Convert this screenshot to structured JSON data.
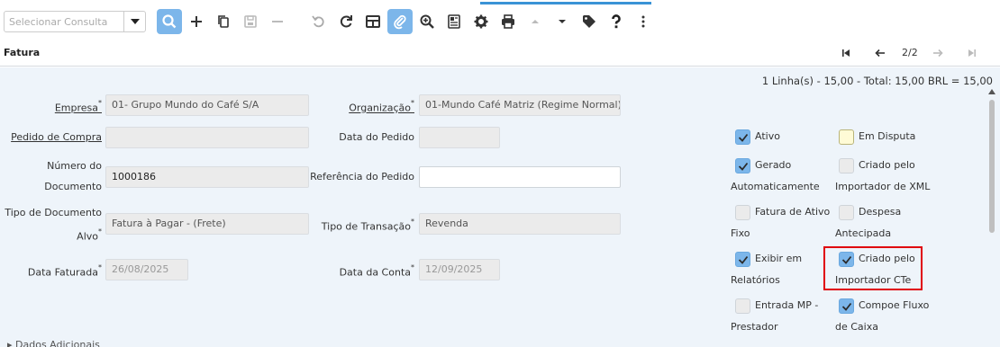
{
  "toolbar": {
    "query_placeholder": "Selecionar Consulta"
  },
  "titlebar": {
    "title": "Fatura",
    "page_count": "2/2"
  },
  "summary": "1 Linha(s) - 15,00 - Total: 15,00 BRL = 15,00",
  "form": {
    "empresa_label": "Empresa",
    "empresa_value": "01- Grupo Mundo do Café S/A",
    "organizacao_label": "Organização",
    "organizacao_value": "01-Mundo Café Matriz (Regime Normal)",
    "pedido_compra_label": "Pedido de Compra",
    "pedido_compra_value": "",
    "data_pedido_label": "Data do Pedido",
    "data_pedido_value": "",
    "numero_doc_label_1": "Número do",
    "numero_doc_label_2": "Documento",
    "numero_doc_value": "1000186",
    "referencia_label": "Referência do Pedido",
    "referencia_value": "",
    "tipo_doc_label_1": "Tipo de Documento",
    "tipo_doc_label_2": "Alvo",
    "tipo_doc_value": "Fatura à Pagar - (Frete)",
    "tipo_transacao_label": "Tipo de Transação",
    "tipo_transacao_value": "Revenda",
    "data_faturada_label": "Data Faturada",
    "data_faturada_value": "26/08/2025",
    "data_conta_label": "Data da Conta",
    "data_conta_value": "12/09/2025",
    "required_mark": "*"
  },
  "checkboxes": {
    "ativo": {
      "label": "Ativo",
      "checked": true
    },
    "em_disputa": {
      "label": "Em Disputa",
      "checked": false
    },
    "gerado_1": "Gerado",
    "gerado_2": "Automaticamente",
    "gerado_checked": true,
    "criado_xml_1": "Criado pelo",
    "criado_xml_2": "Importador de XML",
    "criado_xml_checked": false,
    "fatura_ativo_1": "Fatura de Ativo",
    "fatura_ativo_2": "Fixo",
    "fatura_ativo_checked": false,
    "despesa_1": "Despesa",
    "despesa_2": "Antecipada",
    "despesa_checked": false,
    "exibir_1": "Exibir em",
    "exibir_2": "Relatórios",
    "exibir_checked": true,
    "criado_cte_1": "Criado pelo",
    "criado_cte_2": "Importador CTe",
    "criado_cte_checked": true,
    "entrada_mp_1": "Entrada MP -",
    "entrada_mp_2": "Prestador",
    "entrada_mp_checked": false,
    "compoe_1": "Compoe Fluxo",
    "compoe_2": "de Caixa",
    "compoe_checked": true
  },
  "section": {
    "dados_adicionais": "Dados Adicionais"
  },
  "colors": {
    "accent": "#7cb6ea",
    "highlight": "#e0000a",
    "background": "#eef4fa"
  }
}
